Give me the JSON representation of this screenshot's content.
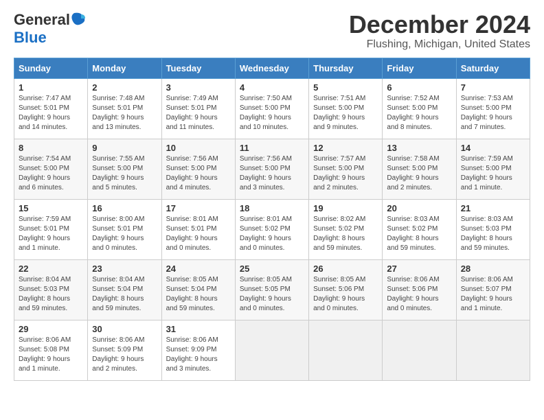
{
  "logo": {
    "line1": "General",
    "line2": "Blue"
  },
  "title": "December 2024",
  "subtitle": "Flushing, Michigan, United States",
  "weekdays": [
    "Sunday",
    "Monday",
    "Tuesday",
    "Wednesday",
    "Thursday",
    "Friday",
    "Saturday"
  ],
  "weeks": [
    [
      {
        "day": "1",
        "sunrise": "Sunrise: 7:47 AM",
        "sunset": "Sunset: 5:01 PM",
        "daylight": "Daylight: 9 hours and 14 minutes."
      },
      {
        "day": "2",
        "sunrise": "Sunrise: 7:48 AM",
        "sunset": "Sunset: 5:01 PM",
        "daylight": "Daylight: 9 hours and 13 minutes."
      },
      {
        "day": "3",
        "sunrise": "Sunrise: 7:49 AM",
        "sunset": "Sunset: 5:01 PM",
        "daylight": "Daylight: 9 hours and 11 minutes."
      },
      {
        "day": "4",
        "sunrise": "Sunrise: 7:50 AM",
        "sunset": "Sunset: 5:00 PM",
        "daylight": "Daylight: 9 hours and 10 minutes."
      },
      {
        "day": "5",
        "sunrise": "Sunrise: 7:51 AM",
        "sunset": "Sunset: 5:00 PM",
        "daylight": "Daylight: 9 hours and 9 minutes."
      },
      {
        "day": "6",
        "sunrise": "Sunrise: 7:52 AM",
        "sunset": "Sunset: 5:00 PM",
        "daylight": "Daylight: 9 hours and 8 minutes."
      },
      {
        "day": "7",
        "sunrise": "Sunrise: 7:53 AM",
        "sunset": "Sunset: 5:00 PM",
        "daylight": "Daylight: 9 hours and 7 minutes."
      }
    ],
    [
      {
        "day": "8",
        "sunrise": "Sunrise: 7:54 AM",
        "sunset": "Sunset: 5:00 PM",
        "daylight": "Daylight: 9 hours and 6 minutes."
      },
      {
        "day": "9",
        "sunrise": "Sunrise: 7:55 AM",
        "sunset": "Sunset: 5:00 PM",
        "daylight": "Daylight: 9 hours and 5 minutes."
      },
      {
        "day": "10",
        "sunrise": "Sunrise: 7:56 AM",
        "sunset": "Sunset: 5:00 PM",
        "daylight": "Daylight: 9 hours and 4 minutes."
      },
      {
        "day": "11",
        "sunrise": "Sunrise: 7:56 AM",
        "sunset": "Sunset: 5:00 PM",
        "daylight": "Daylight: 9 hours and 3 minutes."
      },
      {
        "day": "12",
        "sunrise": "Sunrise: 7:57 AM",
        "sunset": "Sunset: 5:00 PM",
        "daylight": "Daylight: 9 hours and 2 minutes."
      },
      {
        "day": "13",
        "sunrise": "Sunrise: 7:58 AM",
        "sunset": "Sunset: 5:00 PM",
        "daylight": "Daylight: 9 hours and 2 minutes."
      },
      {
        "day": "14",
        "sunrise": "Sunrise: 7:59 AM",
        "sunset": "Sunset: 5:00 PM",
        "daylight": "Daylight: 9 hours and 1 minute."
      }
    ],
    [
      {
        "day": "15",
        "sunrise": "Sunrise: 7:59 AM",
        "sunset": "Sunset: 5:01 PM",
        "daylight": "Daylight: 9 hours and 1 minute."
      },
      {
        "day": "16",
        "sunrise": "Sunrise: 8:00 AM",
        "sunset": "Sunset: 5:01 PM",
        "daylight": "Daylight: 9 hours and 0 minutes."
      },
      {
        "day": "17",
        "sunrise": "Sunrise: 8:01 AM",
        "sunset": "Sunset: 5:01 PM",
        "daylight": "Daylight: 9 hours and 0 minutes."
      },
      {
        "day": "18",
        "sunrise": "Sunrise: 8:01 AM",
        "sunset": "Sunset: 5:02 PM",
        "daylight": "Daylight: 9 hours and 0 minutes."
      },
      {
        "day": "19",
        "sunrise": "Sunrise: 8:02 AM",
        "sunset": "Sunset: 5:02 PM",
        "daylight": "Daylight: 8 hours and 59 minutes."
      },
      {
        "day": "20",
        "sunrise": "Sunrise: 8:03 AM",
        "sunset": "Sunset: 5:02 PM",
        "daylight": "Daylight: 8 hours and 59 minutes."
      },
      {
        "day": "21",
        "sunrise": "Sunrise: 8:03 AM",
        "sunset": "Sunset: 5:03 PM",
        "daylight": "Daylight: 8 hours and 59 minutes."
      }
    ],
    [
      {
        "day": "22",
        "sunrise": "Sunrise: 8:04 AM",
        "sunset": "Sunset: 5:03 PM",
        "daylight": "Daylight: 8 hours and 59 minutes."
      },
      {
        "day": "23",
        "sunrise": "Sunrise: 8:04 AM",
        "sunset": "Sunset: 5:04 PM",
        "daylight": "Daylight: 8 hours and 59 minutes."
      },
      {
        "day": "24",
        "sunrise": "Sunrise: 8:05 AM",
        "sunset": "Sunset: 5:04 PM",
        "daylight": "Daylight: 8 hours and 59 minutes."
      },
      {
        "day": "25",
        "sunrise": "Sunrise: 8:05 AM",
        "sunset": "Sunset: 5:05 PM",
        "daylight": "Daylight: 9 hours and 0 minutes."
      },
      {
        "day": "26",
        "sunrise": "Sunrise: 8:05 AM",
        "sunset": "Sunset: 5:06 PM",
        "daylight": "Daylight: 9 hours and 0 minutes."
      },
      {
        "day": "27",
        "sunrise": "Sunrise: 8:06 AM",
        "sunset": "Sunset: 5:06 PM",
        "daylight": "Daylight: 9 hours and 0 minutes."
      },
      {
        "day": "28",
        "sunrise": "Sunrise: 8:06 AM",
        "sunset": "Sunset: 5:07 PM",
        "daylight": "Daylight: 9 hours and 1 minute."
      }
    ],
    [
      {
        "day": "29",
        "sunrise": "Sunrise: 8:06 AM",
        "sunset": "Sunset: 5:08 PM",
        "daylight": "Daylight: 9 hours and 1 minute."
      },
      {
        "day": "30",
        "sunrise": "Sunrise: 8:06 AM",
        "sunset": "Sunset: 5:09 PM",
        "daylight": "Daylight: 9 hours and 2 minutes."
      },
      {
        "day": "31",
        "sunrise": "Sunrise: 8:06 AM",
        "sunset": "Sunset: 9:09 PM",
        "daylight": "Daylight: 9 hours and 3 minutes."
      },
      null,
      null,
      null,
      null
    ]
  ]
}
